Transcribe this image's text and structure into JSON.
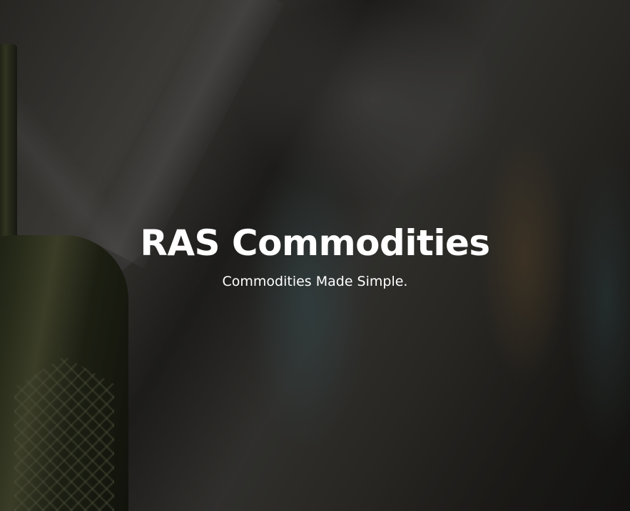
{
  "hero": {
    "title": "RAS Commodities",
    "subtitle": "Commodities Made Simple.",
    "background_image": "blurred-glass-bottles-photo"
  },
  "colors": {
    "text": "#ffffff",
    "overlay": "rgba(0,0,0,0.35)"
  }
}
